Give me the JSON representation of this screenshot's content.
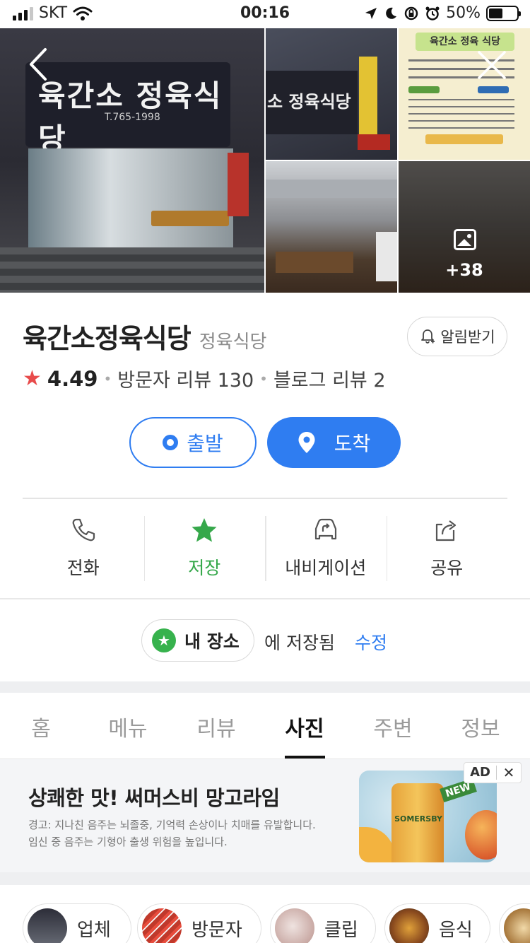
{
  "status_bar": {
    "carrier": "SKT",
    "time": "00:16",
    "battery_text": "50%",
    "battery_level": 0.5
  },
  "photos": {
    "main_sign_text": "육간소 정육식당",
    "main_sign_phone": "T.765-1998",
    "thumb_sign_text": "소 정육식당",
    "menu_header": "육간소 정육 식당",
    "more_count": "+38"
  },
  "place": {
    "name": "육간소정육식당",
    "category": "정육식당",
    "alarm_label": "알림받기",
    "rating": "4.49",
    "visitor_reviews": "방문자 리뷰 130",
    "blog_reviews": "블로그 리뷰 2"
  },
  "route": {
    "depart_label": "출발",
    "arrive_label": "도착"
  },
  "actions": {
    "call": "전화",
    "save": "저장",
    "navigation": "내비게이션",
    "share": "공유"
  },
  "saved": {
    "chip_label": "내 장소",
    "saved_text": "에 저장됨",
    "edit_label": "수정"
  },
  "tabs": [
    "홈",
    "메뉴",
    "리뷰",
    "사진",
    "주변",
    "정보"
  ],
  "active_tab": "사진",
  "ad": {
    "title": "상쾌한 맛! 써머스비 망고라임",
    "warning_line1": "경고: 지나친 음주는 뇌졸중, 기억력 손상이나 치매를 유발합니다.",
    "warning_line2": "임신 중 음주는 기형아 출생 위험을 높입니다.",
    "badge": "AD",
    "close": "✕",
    "image_brand": "SOMERSBY",
    "image_tag": "NEW"
  },
  "filters": [
    "업체",
    "방문자",
    "클립",
    "음식"
  ],
  "colors": {
    "accent_blue": "#2f7df1",
    "saved_green": "#36a84b",
    "rating_red": "#e84b4b"
  }
}
